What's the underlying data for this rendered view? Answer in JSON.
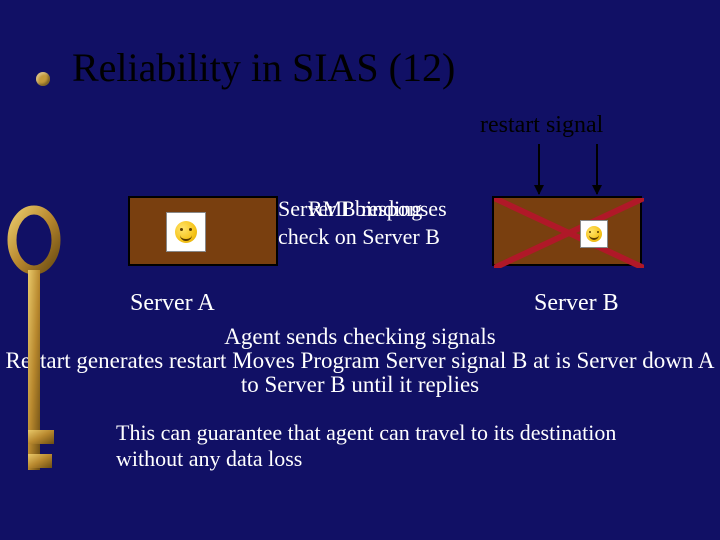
{
  "title": "Reliability in SIAS (12)",
  "restart_signal": "restart signal",
  "mid": {
    "line1_a": "Server B responses",
    "line1_b": "RMI binding",
    "line2": "check on Server B"
  },
  "labels": {
    "server_a": "Server A",
    "server_b": "Server B"
  },
  "center": {
    "line1": "Agent sends checking signals",
    "line2": "Restart generates restart Moves Program Server signal B at is Server down A",
    "line3": "to Server B until it replies"
  },
  "footer": {
    "line1": "This can guarantee that agent can travel to its destination",
    "line2": "without any data loss"
  },
  "icons": {
    "bullet": "bullet",
    "key": "key-icon",
    "smiley": "smiley-icon",
    "cross": "cross-icon"
  },
  "colors": {
    "background": "#111065",
    "box": "#793f0f",
    "accent": "#c49a3a"
  }
}
